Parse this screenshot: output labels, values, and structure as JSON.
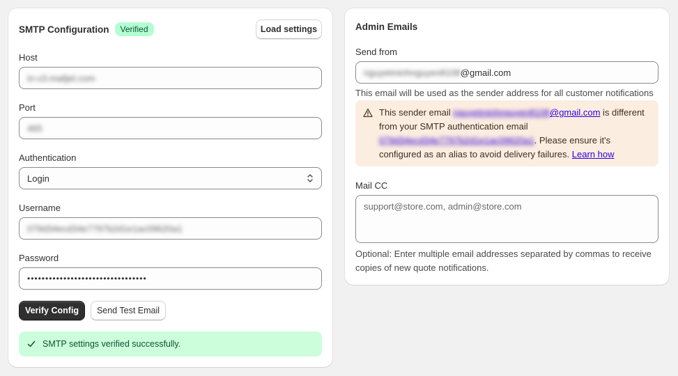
{
  "smtp": {
    "title": "SMTP Configuration",
    "status_badge": "Verified",
    "load_settings_label": "Load settings",
    "host": {
      "label": "Host",
      "value": "in-v3.mailjet.com"
    },
    "port": {
      "label": "Port",
      "value": "465"
    },
    "authentication": {
      "label": "Authentication",
      "value": "Login"
    },
    "username": {
      "label": "Username",
      "value": "079d34ecd34e7797b2d1e1ac09620a1"
    },
    "password": {
      "label": "Password",
      "value": "•••••••••••••••••••••••••••••••••"
    },
    "verify_label": "Verify Config",
    "send_test_label": "Send Test Email",
    "success_message": "SMTP settings verified successfully."
  },
  "admin": {
    "title": "Admin Emails",
    "send_from": {
      "label": "Send from",
      "value_blurred": "nguyetminhnguyen8108",
      "value_domain": "@gmail.com",
      "help": "This email will be used as the sender address for all customer notifications"
    },
    "warning": {
      "text_1": "This sender email ",
      "email_blurred": "nguyetminhnguyen8108",
      "email_domain": "@gmail.com",
      "text_2": " is different from your SMTP authentication email ",
      "smtp_email_blurred": "079d34ecd34e7797b2d1e1ac09620a1",
      "text_3": ". Please ensure it's configured as an alias to avoid delivery failures. ",
      "learn_how": "Learn how"
    },
    "mail_cc": {
      "label": "Mail CC",
      "placeholder": "support@store.com, admin@store.com",
      "help": "Optional: Enter multiple email addresses separated by commas to receive copies of new quote notifications."
    }
  },
  "colors": {
    "page_bg": "#f1f1f1",
    "primary_button": "#303030",
    "verified_badge": "#b4fed2",
    "warning_bg": "#fcede1",
    "success_bg": "#cdfedc",
    "link": "#2c00d6"
  }
}
